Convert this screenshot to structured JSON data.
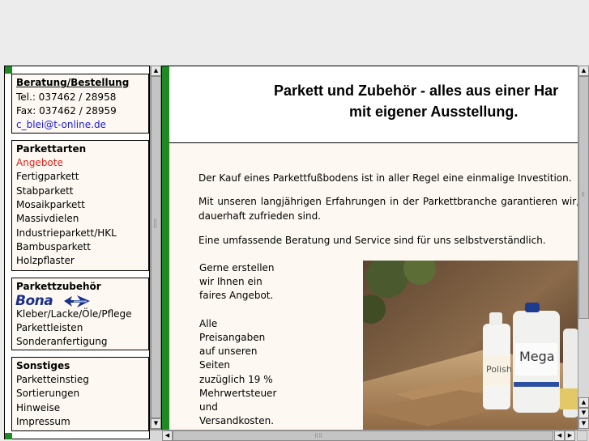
{
  "contact": {
    "heading": "Beratung/Bestellung",
    "phone": "Tel.: 037462 / 28958",
    "fax": "Fax: 037462 / 28959",
    "email": "c_blei@t-online.de"
  },
  "parkettarten": {
    "heading": "Parkettarten",
    "items": [
      "Angebote",
      "Fertigparkett",
      "Stabparkett",
      "Mosaikparkett",
      "Massivdielen",
      "Industrieparkett/HKL",
      "Bambusparkett",
      "Holzpflaster"
    ]
  },
  "zubehoer": {
    "heading": "Parkettzubehör",
    "brand_logo": "Bona",
    "items": [
      "Kleber/Lacke/Öle/Pflege",
      "Parkettleisten",
      "Sonderanfertigung"
    ]
  },
  "sonstiges": {
    "heading": "Sonstiges",
    "items": [
      "Parketteinstieg",
      "Sortierungen",
      "Hinweise",
      "Impressum"
    ]
  },
  "main": {
    "title_line1": "Parkett und Zubehör - alles aus einer Har",
    "title_line2": "mit eigener Ausstellung.",
    "para1": "Der Kauf eines Parkettfußbodens ist in aller Regel eine einmalige Investition.",
    "para2_words": [
      "Mit",
      "unseren",
      "langjährigen",
      "Erfahrungen",
      "in",
      "der",
      "Parkettbranche",
      "garantieren",
      "wir,"
    ],
    "para2_line2": "dauerhaft zufrieden sind.",
    "para3": "Eine umfassende Beratung und Service sind für uns selbstverständlich.",
    "side_lines": [
      "Gerne erstellen",
      "wir Ihnen ein",
      "faires Angebot.",
      "",
      "Alle",
      "Preisangaben",
      "auf unseren",
      "Seiten",
      "zuzüglich 19 %",
      "Mehrwertsteuer",
      "und",
      "Versandkosten."
    ],
    "photo_labels": [
      "Polish",
      "Mega"
    ]
  },
  "colors": {
    "green_strip": "#1f8a24",
    "panel_bg": "#fdf9f2",
    "link_blue": "#1a1adc",
    "link_red": "#e0211b"
  }
}
